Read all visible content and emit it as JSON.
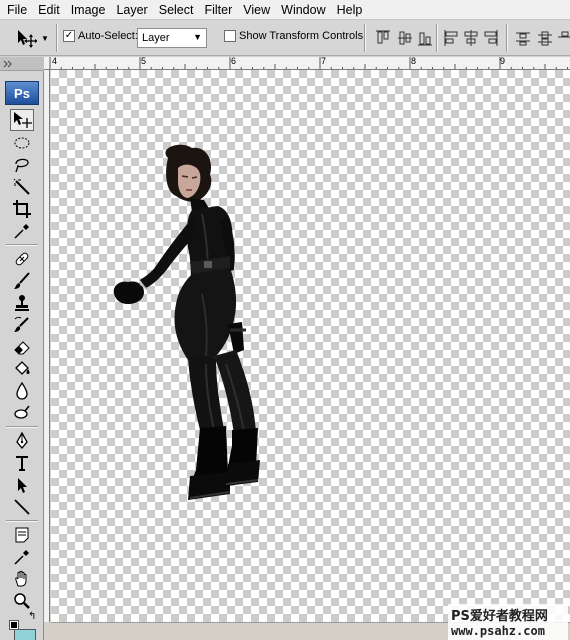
{
  "menu": [
    "File",
    "Edit",
    "Image",
    "Layer",
    "Select",
    "Filter",
    "View",
    "Window",
    "Help"
  ],
  "options_bar": {
    "auto_select_label": "Auto-Select:",
    "auto_select_checked": true,
    "layer_select_value": "Layer",
    "show_transform_label": "Show Transform Controls",
    "show_transform_checked": false
  },
  "tools_panel": {
    "logo": "Ps",
    "tools": [
      "move-icon",
      "elliptical-marquee-icon",
      "lasso-icon",
      "magic-wand-icon",
      "crop-icon",
      "eyedropper-icon",
      "healing-brush-icon",
      "brush-icon",
      "clone-stamp-icon",
      "history-brush-icon",
      "eraser-icon",
      "paint-bucket-icon",
      "blur-icon",
      "dodge-icon",
      "pen-icon",
      "type-icon",
      "path-selection-icon",
      "line-icon",
      "notes-icon",
      "eyedropper-2-icon",
      "hand-icon",
      "zoom-icon"
    ],
    "foreground_color": "#000000",
    "background_color": "#8fd3d9"
  },
  "ruler": {
    "labels": [
      "4",
      "5",
      "6",
      "7",
      "8",
      "9"
    ]
  },
  "watermark": {
    "line1": "PS爱好者教程网",
    "line2": "www.psahz.com"
  }
}
